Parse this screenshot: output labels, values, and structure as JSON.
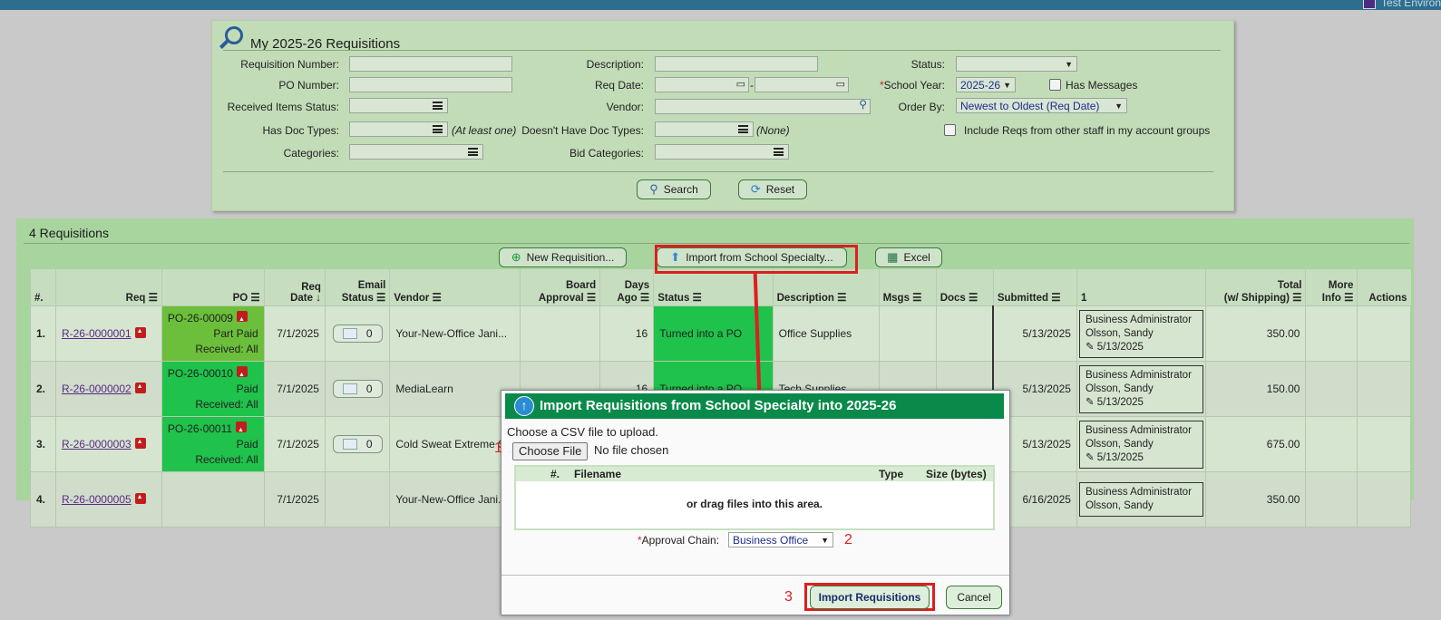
{
  "topbar": {
    "env_label": "Test Environ"
  },
  "filter": {
    "title": "My 2025-26 Requisitions",
    "labels": {
      "req_number": "Requisition Number:",
      "po_number": "PO Number:",
      "received_status": "Received Items Status:",
      "has_doc_types": "Has Doc Types:",
      "categories": "Categories:",
      "description": "Description:",
      "req_date": "Req Date:",
      "vendor": "Vendor:",
      "doesnt_have_doc_types": "Doesn't Have Doc Types:",
      "bid_categories": "Bid Categories:",
      "status": "Status:",
      "school_year": "School Year:",
      "order_by": "Order By:"
    },
    "notes": {
      "at_least_one": "(At least one)",
      "none": "(None)"
    },
    "date_sep": "-",
    "school_year_value": "2025-26",
    "has_messages_label": "Has Messages",
    "order_by_value": "Newest to Oldest (Req Date)",
    "include_reqs_label": "Include Reqs from other staff in my account groups",
    "search_label": "Search",
    "reset_label": "Reset"
  },
  "list": {
    "title": "4 Requisitions",
    "new_req_label": "New Requisition...",
    "import_label": "Import from School Specialty...",
    "excel_label": "Excel",
    "columns": {
      "num": "#.",
      "req": "Req",
      "po": "PO",
      "req_date_1": "Req",
      "req_date_2": "Date ↓",
      "email_1": "Email",
      "email_2": "Status",
      "vendor": "Vendor",
      "board_1": "Board",
      "board_2": "Approval",
      "days_1": "Days",
      "days_2": "Ago",
      "status": "Status",
      "description": "Description",
      "msgs": "Msgs",
      "docs": "Docs",
      "submitted": "Submitted",
      "one": "1",
      "total_1": "Total",
      "total_2": "(w/ Shipping)",
      "more_1": "More",
      "more_2": "Info",
      "actions": "Actions"
    },
    "rows": [
      {
        "num": "1.",
        "req": "R-26-0000001",
        "po": "PO-26-00009",
        "po_paid": "Part Paid",
        "po_received_label": "Received:",
        "po_received": "All",
        "date": "7/1/2025",
        "email_count": "0",
        "vendor": "Your-New-Office Jani...",
        "days": "16",
        "status": "Turned into a PO",
        "description": "Office Supplies",
        "submitted": "5/13/2025",
        "appr_1": "Business Administrator",
        "appr_2": "Olsson, Sandy",
        "appr_date": "5/13/2025",
        "total": "350.00"
      },
      {
        "num": "2.",
        "req": "R-26-0000002",
        "po": "PO-26-00010",
        "po_paid": "Paid",
        "po_received_label": "Received:",
        "po_received": "All",
        "date": "7/1/2025",
        "email_count": "0",
        "vendor": "MediaLearn",
        "days": "16",
        "status": "Turned into a PO",
        "description": "Tech Supplies",
        "submitted": "5/13/2025",
        "appr_1": "Business Administrator",
        "appr_2": "Olsson, Sandy",
        "appr_date": "5/13/2025",
        "total": "150.00"
      },
      {
        "num": "3.",
        "req": "R-26-0000003",
        "po": "PO-26-00011",
        "po_paid": "Paid",
        "po_received_label": "Received:",
        "po_received": "All",
        "date": "7/1/2025",
        "email_count": "0",
        "vendor": "Cold Sweat Extreme S",
        "days": "",
        "status": "",
        "description": "",
        "submitted": "5/13/2025",
        "appr_1": "Business Administrator",
        "appr_2": "Olsson, Sandy",
        "appr_date": "5/13/2025",
        "total": "675.00"
      },
      {
        "num": "4.",
        "req": "R-26-0000005",
        "po": "",
        "po_paid": "",
        "po_received_label": "",
        "po_received": "",
        "date": "7/1/2025",
        "email_count": "",
        "vendor": "Your-New-Office Jani...",
        "days": "",
        "status": "",
        "description": "",
        "submitted": "6/16/2025",
        "appr_1": "Business Administrator",
        "appr_2": "Olsson, Sandy",
        "appr_date": "",
        "total": "350.00"
      }
    ]
  },
  "modal": {
    "title": "Import Requisitions from School Specialty into 2025-26",
    "choose_csv": "Choose a CSV file to upload.",
    "choose_file_btn": "Choose File",
    "no_file": "No file chosen",
    "col_num": "#.",
    "col_filename": "Filename",
    "col_type": "Type",
    "col_size": "Size (bytes)",
    "drag_text": "or drag files into this area.",
    "approval_chain_label": "Approval Chain:",
    "approval_chain_value": "Business Office",
    "import_btn": "Import Requisitions",
    "cancel_btn": "Cancel",
    "step1": "1",
    "step2": "2",
    "step3": "3"
  },
  "colors": {
    "accent_red": "#dd1f1f",
    "modal_header": "#0a8a4a",
    "po_green": "#1fc24b"
  }
}
